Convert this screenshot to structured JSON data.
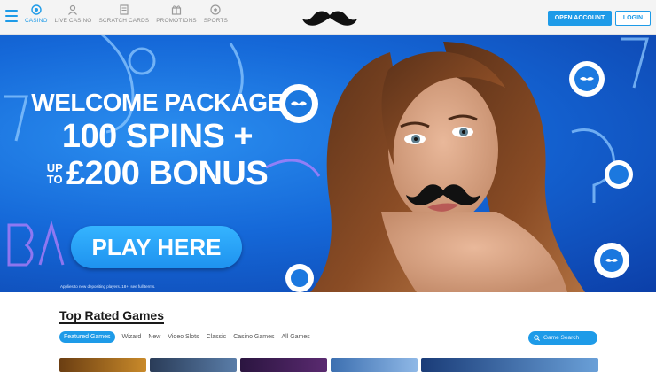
{
  "header": {
    "nav": [
      {
        "label": "CASINO",
        "icon": "casino-chip-icon",
        "active": true
      },
      {
        "label": "LIVE CASINO",
        "icon": "live-dealer-icon",
        "active": false
      },
      {
        "label": "SCRATCH CARDS",
        "icon": "scratch-card-icon",
        "active": false
      },
      {
        "label": "PROMOTIONS",
        "icon": "gift-icon",
        "active": false
      },
      {
        "label": "SPORTS",
        "icon": "football-icon",
        "active": false
      }
    ],
    "logo": "mustache-logo",
    "open_account_label": "OPEN ACCOUNT",
    "login_label": "LOGIN"
  },
  "hero": {
    "line1": "WELCOME PACKAGE",
    "line2": "100 SPINS +",
    "upto_top": "UP",
    "upto_bottom": "TO",
    "amount": "£200 BONUS",
    "cta": "PLAY HERE",
    "disclaimer": "Applies to new depositing players. 18+. see full terms."
  },
  "games": {
    "title": "Top Rated Games",
    "filters": [
      "Featured Games",
      "Wizard",
      "New",
      "Video Slots",
      "Classic",
      "Casino Games",
      "All Games"
    ],
    "search_placeholder": "Game Search"
  },
  "colors": {
    "accent": "#1e9be8",
    "hero_dark": "#0c3fa8",
    "hero_light": "#2b8ff0"
  }
}
